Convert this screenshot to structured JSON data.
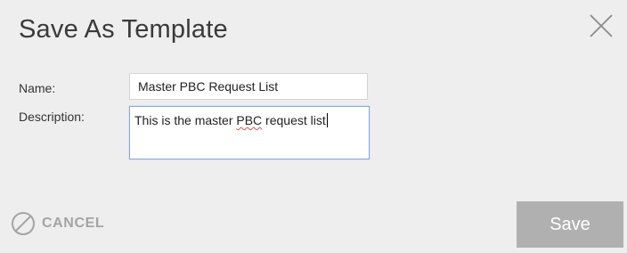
{
  "dialog": {
    "title": "Save As Template",
    "close_icon": "close-icon"
  },
  "form": {
    "name_label": "Name:",
    "name_value": "Master PBC Request List",
    "description_label": "Description:",
    "description_prefix": "This is the master ",
    "description_misspelled": "PBC",
    "description_suffix": " request list"
  },
  "actions": {
    "cancel_icon": "cancel-circle-slash-icon",
    "cancel_label": "CANCEL",
    "save_label": "Save"
  },
  "colors": {
    "background": "#eeeeee",
    "save_button": "#b0b0b0",
    "cancel_text": "#a4a4a4",
    "focus_border": "#8aa6e0"
  }
}
